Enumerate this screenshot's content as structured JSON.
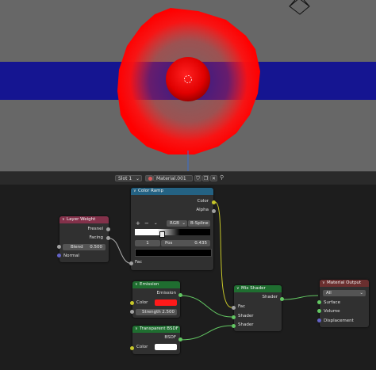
{
  "header": {
    "slot": "Slot 1",
    "material": "Material.001"
  },
  "nodes": {
    "layer_weight": {
      "title": "Layer Weight",
      "out_fresnel": "Fresnel",
      "out_facing": "Facing",
      "blend_label": "Blend",
      "blend_value": "0.500",
      "in_normal": "Normal"
    },
    "color_ramp": {
      "title": "Color Ramp",
      "out_color": "Color",
      "out_alpha": "Alpha",
      "add": "+",
      "remove": "−",
      "mode": "RGB",
      "interpolation": "B-Spline",
      "index": "1",
      "pos_label": "Pos",
      "pos_value": "0.435",
      "in_fac": "Fac"
    },
    "emission": {
      "title": "Emission",
      "out": "Emission",
      "color_label": "Color",
      "color_value": "#ff1a1a",
      "strength_label": "Strength",
      "strength_value": "2.500"
    },
    "transparent": {
      "title": "Transparent BSDF",
      "out": "BSDF",
      "color_label": "Color",
      "color_value": "#ffffff"
    },
    "mix_shader": {
      "title": "Mix Shader",
      "out": "Shader",
      "in_fac": "Fac",
      "in_shader1": "Shader",
      "in_shader2": "Shader"
    },
    "material_output": {
      "title": "Material Output",
      "target": "All",
      "in_surface": "Surface",
      "in_volume": "Volume",
      "in_displacement": "Displacement"
    }
  },
  "colors": {
    "input_header": "#83314a",
    "converter_header": "#246283",
    "shader_header": "#1f6e30",
    "output_header": "#6b2f2f",
    "viewport_bg": "#676767",
    "band": "#151591"
  },
  "icons": [
    "camera-icon",
    "material-sphere-icon",
    "pin-icon",
    "fake-user-icon",
    "close-icon",
    "dropdown-icon"
  ]
}
